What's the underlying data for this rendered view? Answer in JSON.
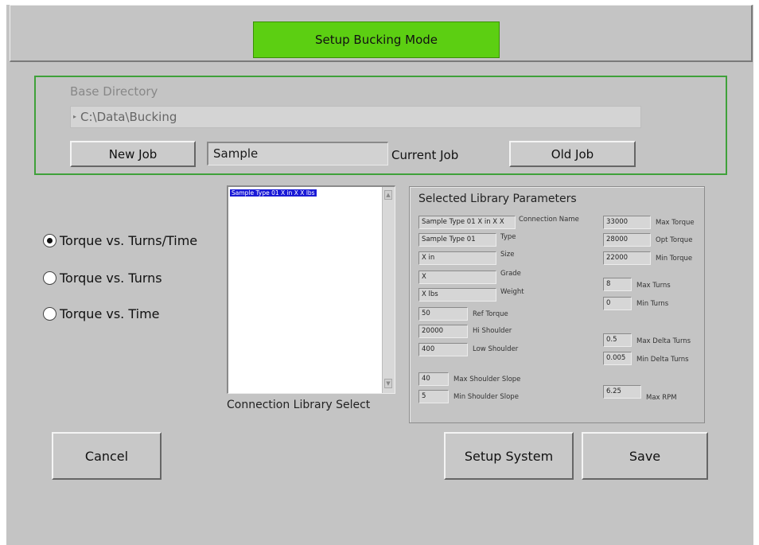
{
  "header": {
    "title": "Setup Bucking Mode"
  },
  "directory": {
    "label": "Base Directory",
    "path": "C:\\Data\\Bucking"
  },
  "job": {
    "new_job_label": "New Job",
    "current_job_value": "Sample",
    "current_job_label": "Current Job",
    "old_job_label": "Old Job"
  },
  "plot_mode": {
    "options": [
      "Torque vs. Turns/Time",
      "Torque vs. Turns",
      "Torque vs. Time"
    ],
    "selected": "Torque vs. Turns/Time"
  },
  "library": {
    "items": [
      "Sample Type 01 X in X X lbs"
    ],
    "selected_index": 0,
    "label": "Connection Library Select"
  },
  "params": {
    "title": "Selected Library Parameters",
    "connection_name": {
      "value": "Sample Type 01 X in X X",
      "label": "Connection Name"
    },
    "type": {
      "value": "Sample Type 01",
      "label": "Type"
    },
    "size": {
      "value": "X in",
      "label": "Size"
    },
    "grade": {
      "value": "X",
      "label": "Grade"
    },
    "weight": {
      "value": "X lbs",
      "label": "Weight"
    },
    "ref_torque": {
      "value": "50",
      "label": "Ref Torque"
    },
    "hi_shoulder": {
      "value": "20000",
      "label": "Hi Shoulder"
    },
    "low_shoulder": {
      "value": "400",
      "label": "Low Shoulder"
    },
    "max_shoulder_slope": {
      "value": "40",
      "label": "Max Shoulder Slope"
    },
    "min_shoulder_slope": {
      "value": "5",
      "label": "Min Shoulder Slope"
    },
    "max_torque": {
      "value": "33000",
      "label": "Max Torque"
    },
    "opt_torque": {
      "value": "28000",
      "label": "Opt Torque"
    },
    "min_torque": {
      "value": "22000",
      "label": "Min Torque"
    },
    "max_turns": {
      "value": "8",
      "label": "Max Turns"
    },
    "min_turns": {
      "value": "0",
      "label": "Min Turns"
    },
    "max_delta_turns": {
      "value": "0.5",
      "label": "Max Delta Turns"
    },
    "min_delta_turns": {
      "value": "0.005",
      "label": "Min Delta Turns"
    },
    "max_rpm": {
      "value": "6.25",
      "label": "Max RPM"
    }
  },
  "actions": {
    "cancel_label": "Cancel",
    "setup_system_label": "Setup System",
    "save_label": "Save"
  },
  "colors": {
    "title_bg": "#5ccf12",
    "group_border": "#3fa13a",
    "panel_bg": "#c4c4c4",
    "list_selection": "#1a1ad6"
  }
}
